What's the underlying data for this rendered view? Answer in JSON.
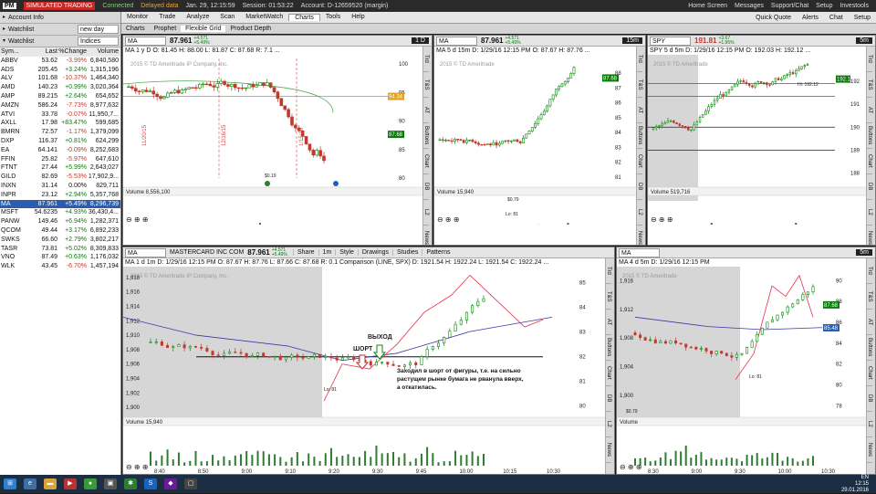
{
  "topbar": {
    "logo": "PM",
    "mode": "SIMULATED TRADING",
    "connected": "Connected",
    "delayed": "Delayed data",
    "datetime": "Jan. 29, 12:15:59",
    "session": "Session: 01:53:22",
    "account": "Account: D-12659520 (margin)",
    "home": "Home Screen",
    "messages": "Messages",
    "support": "Support/Chat",
    "setup": "Setup",
    "brand": "Investools"
  },
  "left": {
    "account_info": "Account Info",
    "watchlist1": "Watchlist",
    "watchlist1_val": "new day",
    "watchlist2": "Watchlist",
    "watchlist2_val": "Indices",
    "headers": [
      "Sym...",
      "Last",
      "%Change",
      "Volume"
    ],
    "rows": [
      [
        "ABBV",
        "53.62",
        "-3.99%",
        "6,840,580",
        "dn"
      ],
      [
        "ADS",
        "205.45",
        "+3.24%",
        "1,315,196",
        "up"
      ],
      [
        "ALV",
        "101.68",
        "-10.37%",
        "1,464,340",
        "dn"
      ],
      [
        "AMD",
        "140.23",
        "+0.99%",
        "3,020,364",
        "up"
      ],
      [
        "AMP",
        "89.215",
        "+2.64%",
        "654,652",
        "up"
      ],
      [
        "AMZN",
        "586.24",
        "-7.73%",
        "8,977,632",
        "dn"
      ],
      [
        "ATVI",
        "33.78",
        "-0.07%",
        "11,950,7...",
        "dn"
      ],
      [
        "AXLL",
        "17.98",
        "+83.47%",
        "599,685",
        "up"
      ],
      [
        "BMRN",
        "72.57",
        "-1.17%",
        "1,379,099",
        "dn"
      ],
      [
        "DXP",
        "116.37",
        "+0.81%",
        "624,299",
        "up"
      ],
      [
        "EA",
        "64.141",
        "-0.09%",
        "8,252,683",
        "dn"
      ],
      [
        "FFIN",
        "25.82",
        "-5.97%",
        "647,610",
        "dn"
      ],
      [
        "FTNT",
        "27.44",
        "+5.99%",
        "2,643,027",
        "up"
      ],
      [
        "GILD",
        "82.69",
        "-5.53%",
        "17,902,9...",
        "dn"
      ],
      [
        "INXN",
        "31.14",
        "0.00%",
        "829,711",
        ""
      ],
      [
        "INPR",
        "23.12",
        "+2.94%",
        "5,357,768",
        "up"
      ],
      [
        "MA",
        "87.961",
        "+5.49%",
        "8,296,739",
        "up"
      ],
      [
        "MSFT",
        "54.6235",
        "+4.93%",
        "36,430,4...",
        "up"
      ],
      [
        "PANW",
        "149.46",
        "+6.94%",
        "1,282,371",
        "up"
      ],
      [
        "QCOM",
        "49.44",
        "+3.17%",
        "6,892,233",
        "up"
      ],
      [
        "SWKS",
        "66.60",
        "+2.79%",
        "3,802,217",
        "up"
      ],
      [
        "TASR",
        "73.81",
        "+5.02%",
        "8,309,833",
        "up"
      ],
      [
        "VNO",
        "87.49",
        "+0.63%",
        "1,176,032",
        "up"
      ],
      [
        "WLK",
        "43.45",
        "-6.70%",
        "1,457,194",
        "dn"
      ]
    ]
  },
  "menu": {
    "items": [
      "Monitor",
      "Trade",
      "Analyze",
      "Scan",
      "MarketWatch",
      "Charts",
      "Tools",
      "Help"
    ],
    "active": "Charts",
    "right": [
      "Quick Quote",
      "Alerts",
      "Chat",
      "Setup"
    ]
  },
  "subbar": {
    "items": [
      "Charts",
      "Prophet",
      "Flexible Grid",
      "Product Depth"
    ],
    "active": "Flexible Grid"
  },
  "p1": {
    "sym": "MA",
    "price": "87.961",
    "chg": "+4.571\n+5.49%",
    "tf": "1 D",
    "info": "MA 1 y D   O: 81.45  H: 88.00  L: 81.87  C: 87.68  R: 7.1  ...",
    "copy": "2015 © TD Ameritrade IP Company, Inc.",
    "vol": "Volume  8,556,100",
    "xt": [
      "11/30",
      "12/7",
      "12/14",
      "1/4",
      "1/11",
      "1/18",
      "2/1",
      "2/8",
      "2/15"
    ],
    "yt": [
      "100",
      "95",
      "90",
      "85",
      "80"
    ],
    "tag1": "94.34",
    "tag2": "87.68",
    "ev1": "11/20/15",
    "ev2": "12/16/15",
    "ev3": "1/15/16",
    "div": "$0.19",
    "div2": "$0.19",
    "vol_unit": "million"
  },
  "p2": {
    "sym": "MA",
    "price": "87.961",
    "chg": "+4.571\n+5.49%",
    "tf": "15m",
    "info": "MA 5 d 15m   D: 1/29/16 12:15 PM   O: 87.67   H: 87.76   ...",
    "copy": "2015 © TD Ameritrade",
    "vol": "Volume  15,940",
    "xt": [
      "13",
      "14",
      "15",
      "Fri",
      "10",
      "11",
      "12"
    ],
    "yt": [
      "88",
      "87",
      "86",
      "85",
      "84",
      "83",
      "82",
      "81"
    ],
    "tag": "87.68",
    "low": "Lo: 81",
    "div": "$0.79",
    "vol_unit": "million"
  },
  "p3": {
    "sym": "SPY",
    "price": "191.81",
    "chg": "+3.67\n+1.95%",
    "tf": "5m",
    "info": "SPY 5 d 5m   D: 1/29/16 12:15 PM   O: 192.03   H: 192.12   ...",
    "copy": "2015 © TD Ameritrade",
    "vol": "Volume  519,716",
    "xt": [
      "9:00",
      "10:00",
      "11:00",
      "12:00",
      "13:00"
    ],
    "yt": [
      "192",
      "191",
      "190",
      "189",
      "188"
    ],
    "tag": "192.1",
    "hi": "Hi: 192.12",
    "vol_unit": "million"
  },
  "p4": {
    "sym": "MA",
    "name": "MASTERCARD INC COM",
    "price": "87.961",
    "chg": "+4.571\n+5.49%",
    "tools": [
      "Share",
      "1m",
      "Style",
      "Drawings",
      "Studies",
      "Patterns"
    ],
    "info": "MA 1 d 1m   D: 1/29/16 12:15 PM   O: 87.67   H: 87.76   L: 87.66   C: 87.68   R: 0.1   Comparison (LINE, SPX)  D: 1921.54  H: 1922.24  L: 1921.54  C: 1922.24 ...",
    "copy": "2015 © TD Ameritrade IP Company, Inc.",
    "vol": "Volume  15,940",
    "xt": [
      "8:40",
      "8:50",
      "9:00",
      "9:10",
      "9:20",
      "9:30",
      "9:45",
      "10:00",
      "10:15",
      "10:30"
    ],
    "yl": [
      "1,918",
      "1,916",
      "1,914",
      "1,912",
      "1,910",
      "1,908",
      "1,906",
      "1,904",
      "1,902",
      "1,900"
    ],
    "yr": [
      "85",
      "84",
      "83",
      "82",
      "81",
      "80"
    ],
    "low": "Lo: 81",
    "short": "ШОРТ",
    "exit": "ВЫХОД",
    "note": "Заходил в шорт от фигуры, т.е. на сильно\nрастущем рынке бумага не рванула вверх,\nа откатилась.",
    "vol_unit": "thousa..."
  },
  "p5": {
    "sym": "MA",
    "tf": "5m",
    "info": "MA 4 d 5m   D: 1/29/16 12:15 PM",
    "copy": "2015 © TD Ameritrade",
    "vol": "Volume",
    "xt": [
      "8:30",
      "9:00",
      "9:30",
      "10:00",
      "10:30"
    ],
    "yt": [
      "90",
      "88",
      "86",
      "84",
      "82",
      "80",
      "78"
    ],
    "yl": [
      "1,916",
      "1,912",
      "1,908",
      "1,904",
      "1,900"
    ],
    "tag1": "87.68",
    "tag2": "85.48",
    "low": "Lo: 81",
    "div": "$0.79",
    "vol_unit": "thousa..."
  },
  "stripe": [
    "Trd",
    "T&S",
    "AT",
    "Buttons",
    "Chart",
    "DB",
    "L2",
    "News"
  ],
  "taskbar": {
    "lang": "EN",
    "time": "12:15",
    "date": "29.01.2016"
  },
  "colors": {
    "up": "#0a7a0a",
    "dn": "#c0392b",
    "sma": "#3a3aa8",
    "cmp": "#e8334a"
  }
}
